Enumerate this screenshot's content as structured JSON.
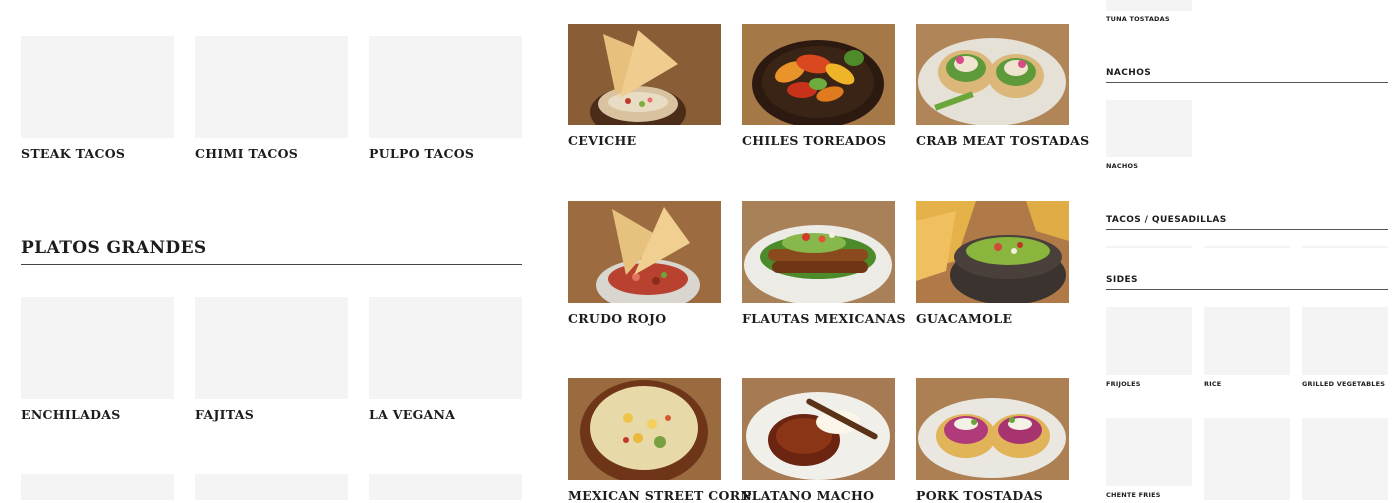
{
  "left": {
    "row1": [
      "STEAK TACOS",
      "CHIMI TACOS",
      "PULPO TACOS"
    ],
    "section_title": "PLATOS GRANDES",
    "row2": [
      "ENCHILADAS",
      "FAJITAS",
      "LA VEGANA"
    ]
  },
  "middle": {
    "items": [
      "CEVICHE",
      "CHILES TOREADOS",
      "CRAB MEAT TOSTADAS",
      "CRUDO ROJO",
      "FLAUTAS MEXICANAS",
      "GUACAMOLE",
      "MEXICAN STREET CORN",
      "PLATANO MACHO",
      "PORK TOSTADAS"
    ]
  },
  "sidebar": {
    "top_item": "TUNA TOSTADAS",
    "nachos_title": "NACHOS",
    "nachos_item": "NACHOS",
    "tacos_title": "TACOS / QUESADILLAS",
    "sides_title": "SIDES",
    "sides_items": [
      "FRIJOLES",
      "RICE",
      "GRILLED VEGETABLES"
    ],
    "sides_row2_item": "CHENTE FRIES"
  }
}
